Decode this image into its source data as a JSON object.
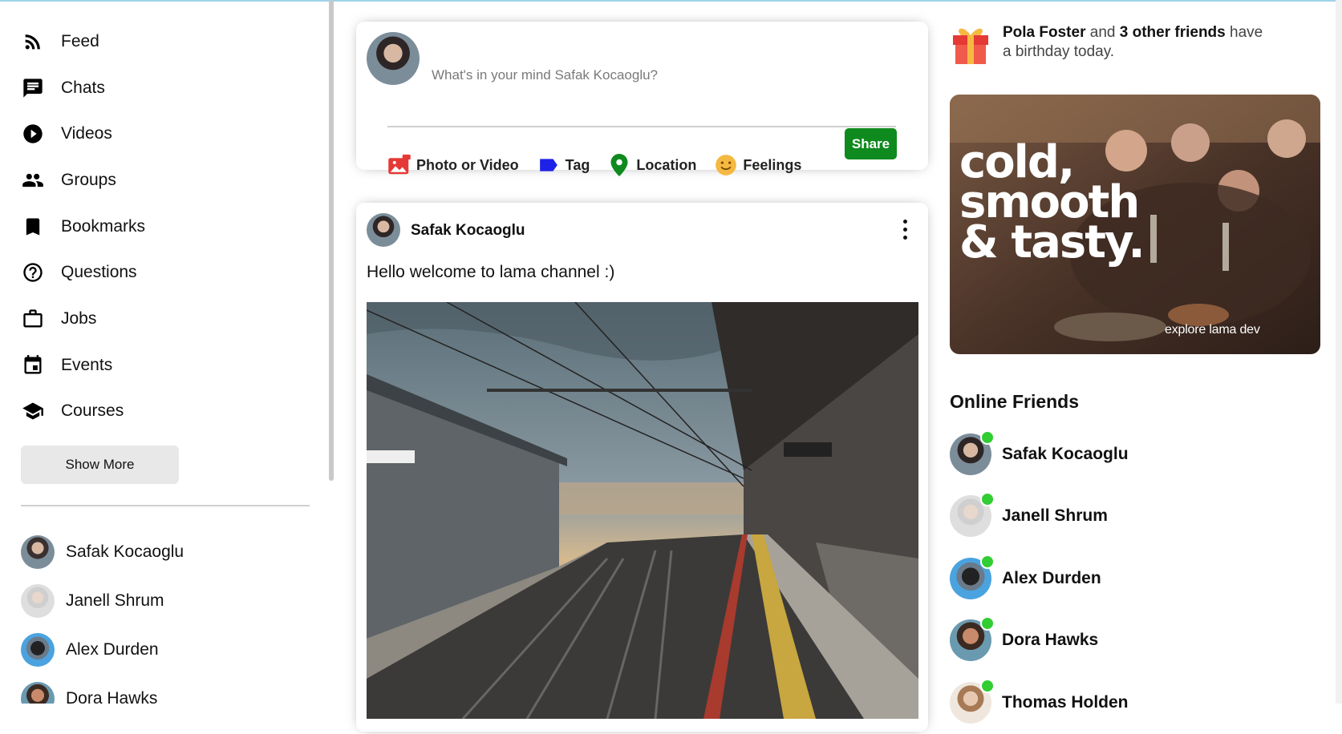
{
  "sidebar": {
    "items": [
      {
        "label": "Feed",
        "icon": "rss-feed-icon"
      },
      {
        "label": "Chats",
        "icon": "chat-icon"
      },
      {
        "label": "Videos",
        "icon": "play-circle-icon"
      },
      {
        "label": "Groups",
        "icon": "group-icon"
      },
      {
        "label": "Bookmarks",
        "icon": "bookmark-icon"
      },
      {
        "label": "Questions",
        "icon": "help-outline-icon"
      },
      {
        "label": "Jobs",
        "icon": "work-outline-icon"
      },
      {
        "label": "Events",
        "icon": "event-icon"
      },
      {
        "label": "Courses",
        "icon": "school-icon"
      }
    ],
    "show_more": "Show More",
    "friends": [
      "Safak Kocaoglu",
      "Janell Shrum",
      "Alex Durden",
      "Dora Hawks"
    ]
  },
  "share": {
    "placeholder": "What's in your mind Safak Kocaoglu?",
    "options": [
      {
        "label": "Photo or Video",
        "color": "#e53935"
      },
      {
        "label": "Tag",
        "color": "#1e22e6"
      },
      {
        "label": "Location",
        "color": "#0f8a1e"
      },
      {
        "label": "Feelings",
        "color": "#f5b942"
      }
    ],
    "button": "Share"
  },
  "post": {
    "username": "Safak Kocaoglu",
    "text": "Hello welcome to lama channel :)"
  },
  "rightbar": {
    "birthday": {
      "name": "Pola Foster",
      "connector": " and ",
      "others": "3 other friends",
      "suffix": " have a birthday today."
    },
    "ad": {
      "title": "cold,\nsmooth\n& tasty.",
      "footer": "explore lama dev"
    },
    "online_title": "Online Friends",
    "online_friends": [
      "Safak Kocaoglu",
      "Janell Shrum",
      "Alex Durden",
      "Dora Hawks",
      "Thomas Holden"
    ]
  },
  "colors": {
    "accent_green": "#0f8a1e",
    "online_dot": "#32cd32"
  }
}
